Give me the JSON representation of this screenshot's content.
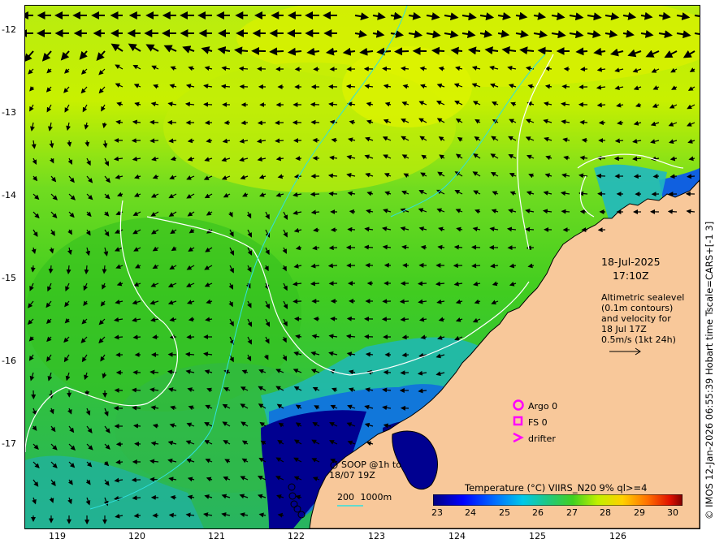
{
  "map": {
    "y_ticks": [
      "-12",
      "-13",
      "-14",
      "-15",
      "-16",
      "-17"
    ],
    "x_ticks": [
      "119",
      "120",
      "121",
      "122",
      "123",
      "124",
      "125",
      "126"
    ],
    "date": "18-Jul-2025",
    "time": "17:10Z",
    "description": [
      "Altimetric sealevel",
      "(0.1m contours)",
      "and velocity for",
      "18 Jul 17Z",
      "0.5m/s (1kt 24h)"
    ],
    "legend": {
      "argo": "Argo 0",
      "fs": "FS 0",
      "drifter": "drifter"
    },
    "soop": [
      "SOOP @1h to",
      "18/07 19Z"
    ],
    "isobaths": [
      "200",
      "1000m"
    ],
    "colorbar": {
      "title": "Temperature (°C) VIIRS_N20 9% ql>=4",
      "ticks": [
        "23",
        "24",
        "25",
        "26",
        "27",
        "28",
        "29",
        "30"
      ]
    },
    "credit": "© IMOS 12-Jan-2026 06:55:39 Hobart time Tscale=CARS+[-1 3]",
    "colors": {
      "land": "#f8c89a",
      "argo_marker": "#ff00ff",
      "sst_warm": "#c8f000",
      "sst_mid": "#3cd020",
      "sst_cool": "#20b8c0",
      "sst_cold": "#000080"
    },
    "icons": [
      "argo-circle-icon",
      "floatstation-square-icon",
      "drifter-chevron-icon",
      "velocity-arrow-icon"
    ]
  }
}
